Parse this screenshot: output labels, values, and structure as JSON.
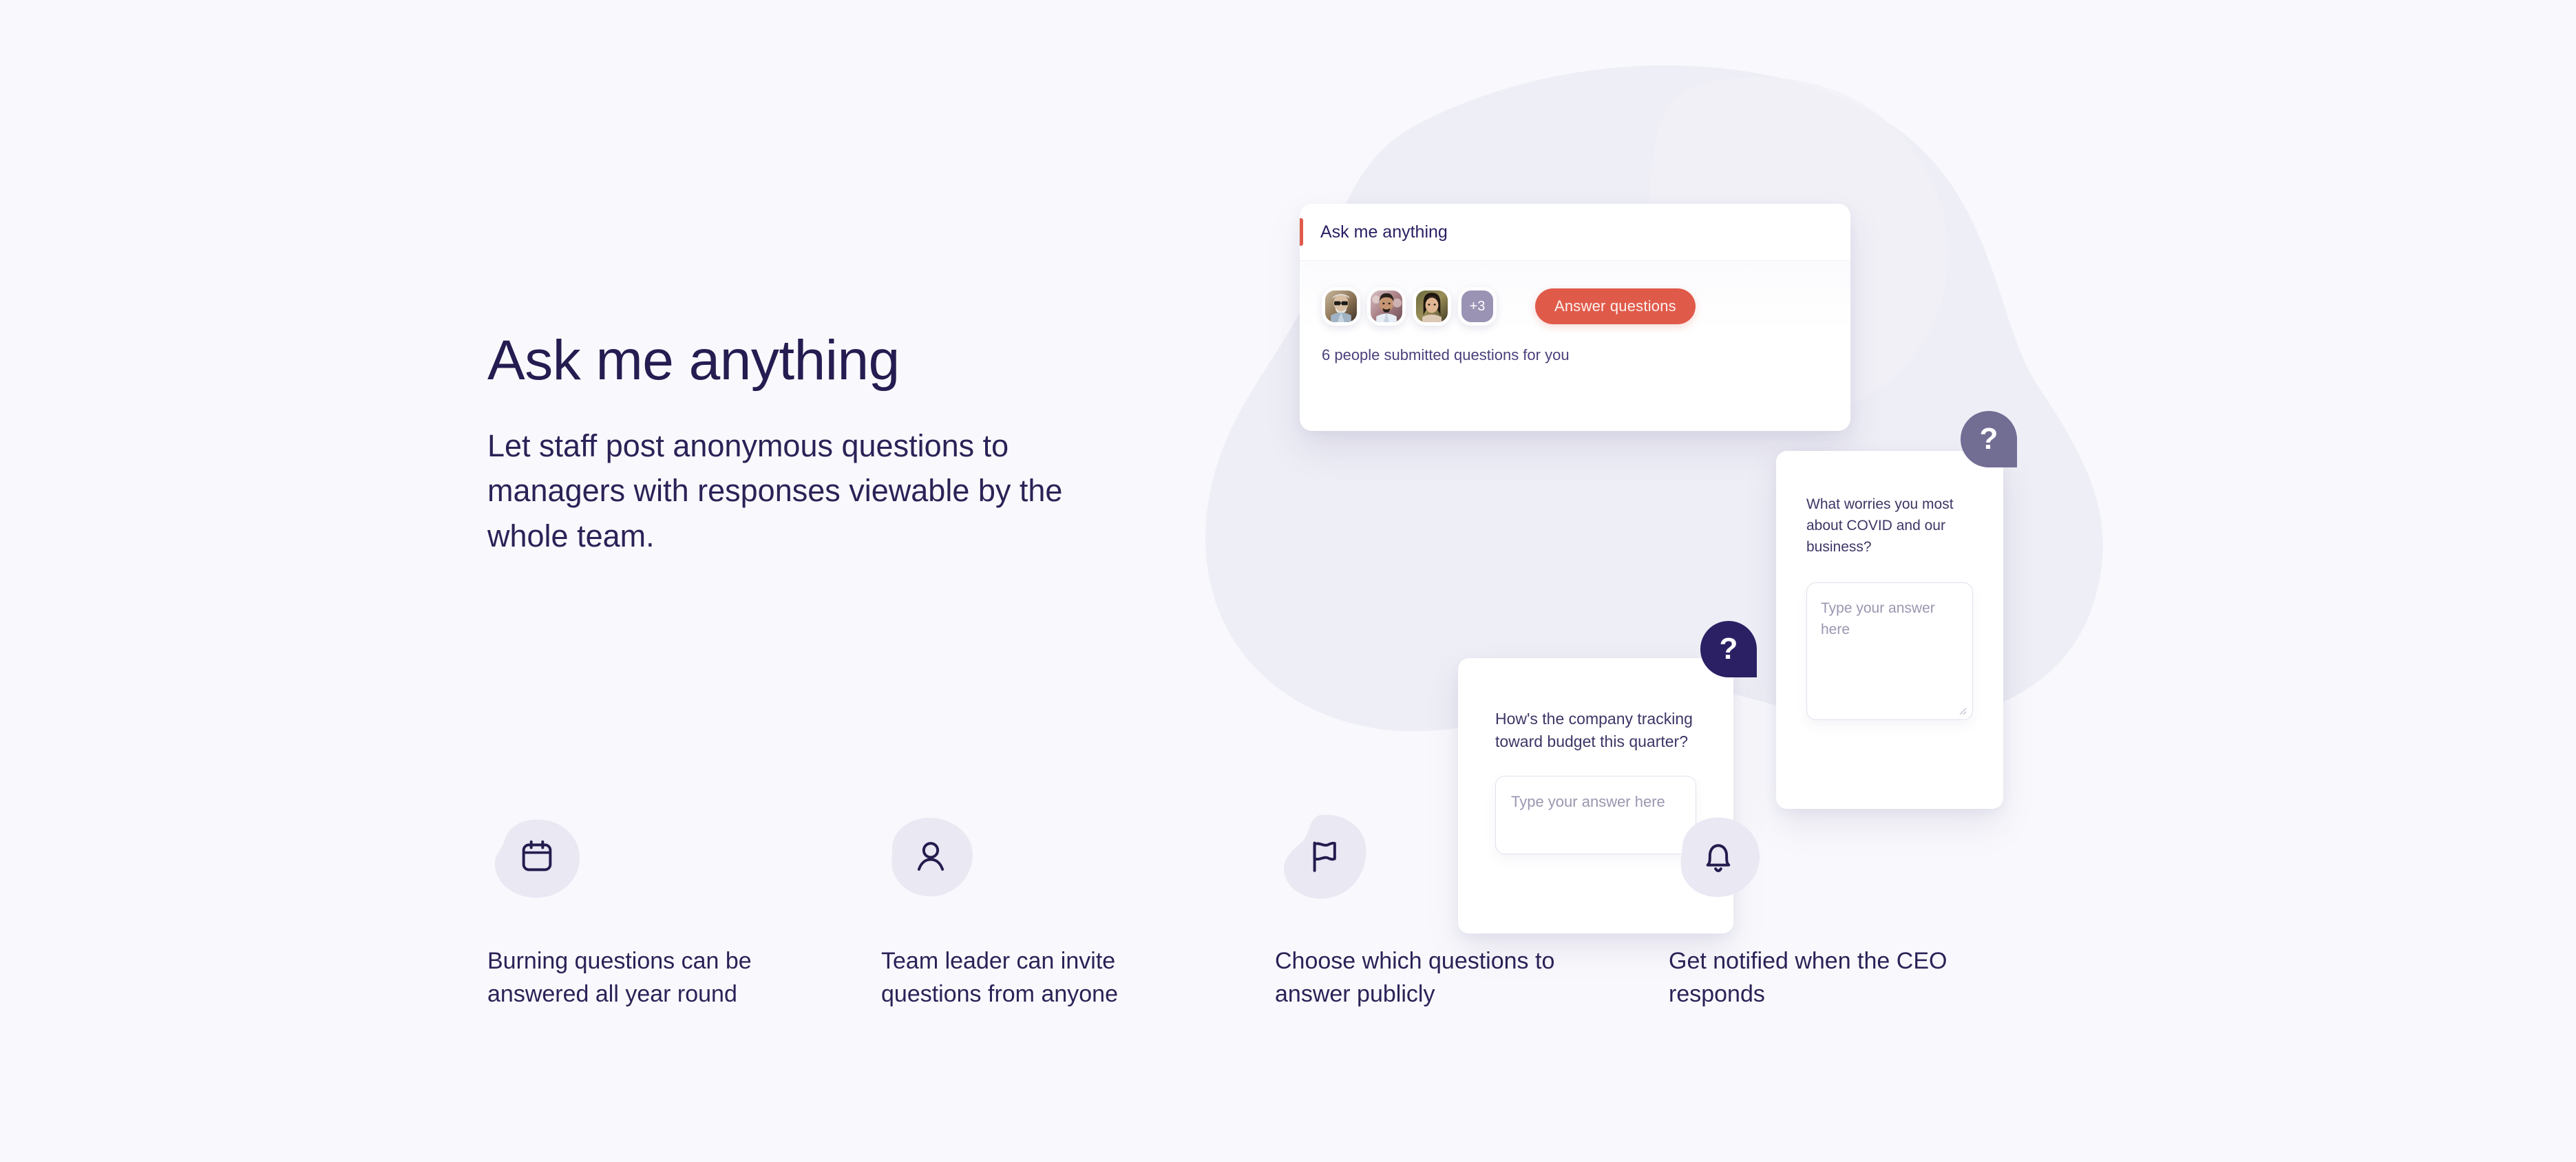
{
  "page": {
    "background_color": "#f9f9fd",
    "blob_color": "#ededf6"
  },
  "hero": {
    "title": "Ask me anything",
    "subtitle": "Let staff post anonymous questions to managers with responses viewable by the whole team."
  },
  "illustration": {
    "ama_card": {
      "title": "Ask me anything",
      "accent_color": "#e05a4a",
      "avatars": [
        {
          "name": "avatar-person-1",
          "alt": "Elderly man with glasses"
        },
        {
          "name": "avatar-person-2",
          "alt": "Young man with beard"
        },
        {
          "name": "avatar-person-3",
          "alt": "Smiling woman"
        }
      ],
      "avatar_overflow_label": "+3",
      "answer_button_label": "Answer questions",
      "submitted_note": "6 people submitted questions for you"
    },
    "question_cards": [
      {
        "question": "How's the company tracking toward budget this quarter?",
        "answer_placeholder": "Type your answer here",
        "badge_label": "?",
        "badge_color": "#2b2064"
      },
      {
        "question": "What worries you most about COVID and our business?",
        "answer_placeholder": "Type your answer here",
        "badge_label": "?",
        "badge_color": "#726d93"
      }
    ]
  },
  "features": [
    {
      "icon": "calendar-icon",
      "label": "Burning questions can be answered all year round"
    },
    {
      "icon": "user-icon",
      "label": "Team leader can invite questions from anyone"
    },
    {
      "icon": "flag-icon",
      "label": "Choose which questions to answer publicly"
    },
    {
      "icon": "bell-icon",
      "label": "Get notified when the CEO responds"
    }
  ]
}
